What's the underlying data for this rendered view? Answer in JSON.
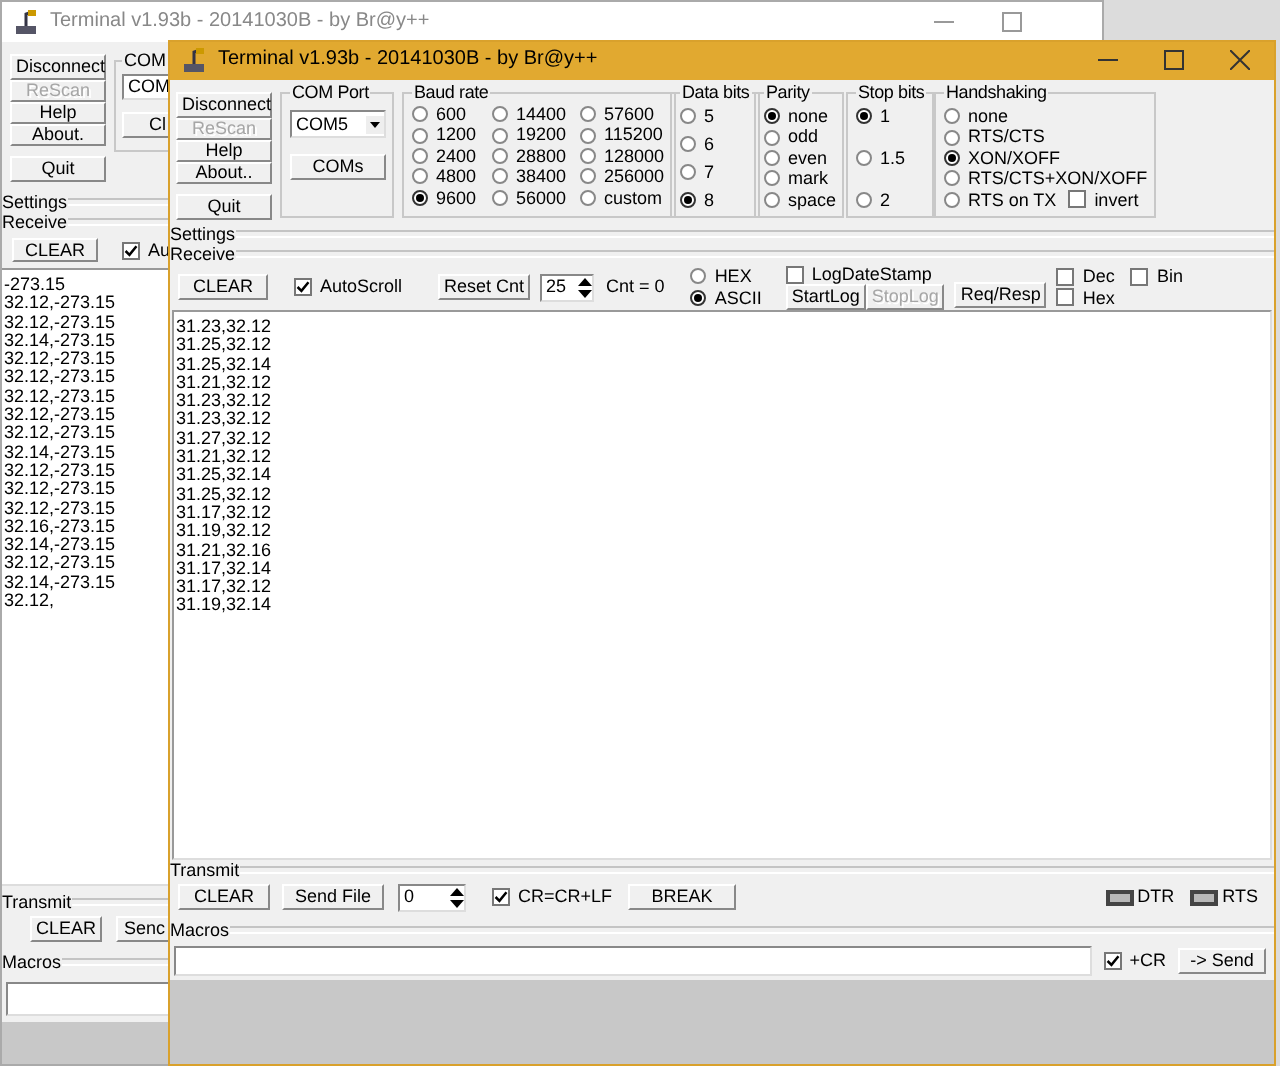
{
  "back_window": {
    "title": "Terminal v1.93b - 20141030B - by Br@y++",
    "buttons": [
      {
        "label": "Disconnect",
        "disabled": false
      },
      {
        "label": "ReScan",
        "disabled": true
      },
      {
        "label": "Help",
        "disabled": false
      },
      {
        "label": "About.",
        "disabled": false
      },
      {
        "label": "Quit",
        "disabled": false
      }
    ],
    "com_port": {
      "label": "COM",
      "value": "COM",
      "button": "Cl"
    },
    "settings_label": "Settings",
    "receive": {
      "label": "Receive",
      "clear": "CLEAR",
      "autoscroll": {
        "label": "Au",
        "checked": true
      },
      "lines": [
        "-273.15",
        "32.12,-273.15",
        "32.12,-273.15",
        "32.14,-273.15",
        "32.12,-273.15",
        "32.12,-273.15",
        "32.12,-273.15",
        "32.12,-273.15",
        "32.12,-273.15",
        "32.14,-273.15",
        "32.12,-273.15",
        "32.12,-273.15",
        "32.12,-273.15",
        "32.16,-273.15",
        "32.14,-273.15",
        "32.12,-273.15",
        "32.14,-273.15",
        "32.12,"
      ]
    },
    "transmit": {
      "label": "Transmit",
      "clear": "CLEAR",
      "send_file": "Senc"
    },
    "macros_label": "Macros"
  },
  "front_window": {
    "title": "Terminal v1.93b - 20141030B - by Br@y++",
    "buttons": [
      {
        "label": "Disconnect",
        "disabled": false
      },
      {
        "label": "ReScan",
        "disabled": true
      },
      {
        "label": "Help",
        "disabled": false
      },
      {
        "label": "About..",
        "disabled": false
      },
      {
        "label": "Quit",
        "disabled": false
      }
    ],
    "com_port": {
      "label": "COM Port",
      "value": "COM5",
      "button": "COMs"
    },
    "baud_rate": {
      "label": "Baud rate",
      "options": [
        {
          "label": "600",
          "selected": false
        },
        {
          "label": "1200",
          "selected": false
        },
        {
          "label": "2400",
          "selected": false
        },
        {
          "label": "4800",
          "selected": false
        },
        {
          "label": "9600",
          "selected": true
        },
        {
          "label": "14400",
          "selected": false
        },
        {
          "label": "19200",
          "selected": false
        },
        {
          "label": "28800",
          "selected": false
        },
        {
          "label": "38400",
          "selected": false
        },
        {
          "label": "56000",
          "selected": false
        },
        {
          "label": "57600",
          "selected": false
        },
        {
          "label": "115200",
          "selected": false
        },
        {
          "label": "128000",
          "selected": false
        },
        {
          "label": "256000",
          "selected": false
        },
        {
          "label": "custom",
          "selected": false
        }
      ]
    },
    "data_bits": {
      "label": "Data bits",
      "options": [
        {
          "label": "5",
          "selected": false
        },
        {
          "label": "6",
          "selected": false
        },
        {
          "label": "7",
          "selected": false
        },
        {
          "label": "8",
          "selected": true
        }
      ]
    },
    "parity": {
      "label": "Parity",
      "options": [
        {
          "label": "none",
          "selected": true
        },
        {
          "label": "odd",
          "selected": false
        },
        {
          "label": "even",
          "selected": false
        },
        {
          "label": "mark",
          "selected": false
        },
        {
          "label": "space",
          "selected": false
        }
      ]
    },
    "stop_bits": {
      "label": "Stop bits",
      "options": [
        {
          "label": "1",
          "selected": true
        },
        {
          "label": "1.5",
          "selected": false
        },
        {
          "label": "2",
          "selected": false
        }
      ]
    },
    "handshaking": {
      "label": "Handshaking",
      "options": [
        {
          "label": "none",
          "selected": false
        },
        {
          "label": "RTS/CTS",
          "selected": false
        },
        {
          "label": "XON/XOFF",
          "selected": true
        },
        {
          "label": "RTS/CTS+XON/XOFF",
          "selected": false
        },
        {
          "label": "RTS on TX",
          "selected": false
        }
      ],
      "invert": {
        "label": "invert",
        "checked": false
      }
    },
    "settings_label": "Settings",
    "receive": {
      "label": "Receive",
      "clear": "CLEAR",
      "autoscroll": {
        "label": "AutoScroll",
        "checked": true
      },
      "reset": "Reset Cnt",
      "count": "25",
      "counter": "Cnt = 0",
      "modes": [
        {
          "label": "HEX",
          "selected": false
        },
        {
          "label": "ASCII",
          "selected": true
        }
      ],
      "log_date_stamp": {
        "label": "LogDateStamp",
        "checked": false
      },
      "start_log": {
        "label": "StartLog",
        "disabled": false
      },
      "stop_log": {
        "label": "StopLog",
        "disabled": true
      },
      "req_resp": "Req/Resp",
      "dec": {
        "label": "Dec",
        "checked": false
      },
      "bin": {
        "label": "Bin",
        "checked": false
      },
      "hex": {
        "label": "Hex",
        "checked": false
      },
      "lines": [
        "31.23,32.12",
        "31.25,32.12",
        "31.25,32.14",
        "31.21,32.12",
        "31.23,32.12",
        "31.23,32.12",
        "31.27,32.12",
        "31.21,32.12",
        "31.25,32.14",
        "31.25,32.12",
        "31.17,32.12",
        "31.19,32.12",
        "31.21,32.16",
        "31.17,32.14",
        "31.17,32.12",
        "31.19,32.14"
      ]
    },
    "transmit": {
      "label": "Transmit",
      "clear": "CLEAR",
      "send_file": "Send File",
      "count": "0",
      "cr_lf": {
        "label": "CR=CR+LF",
        "checked": true
      },
      "break": "BREAK",
      "leds": [
        {
          "label": "DTR",
          "on": false
        },
        {
          "label": "RTS",
          "on": false
        }
      ]
    },
    "macros": {
      "label": "Macros",
      "plus_cr": {
        "label": "+CR",
        "checked": true
      },
      "send": "-> Send"
    }
  }
}
